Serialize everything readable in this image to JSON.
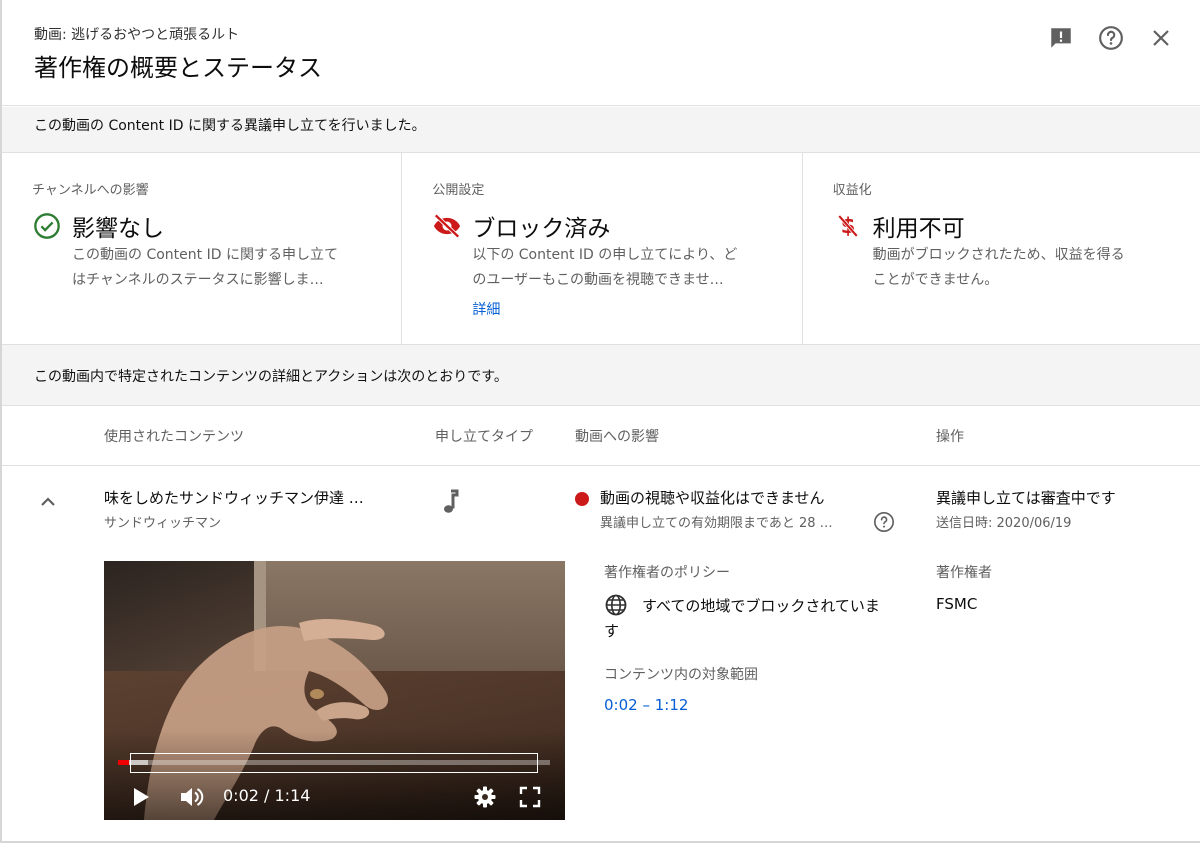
{
  "header": {
    "video_label": "動画: 逃げるおやつと頑張るルト",
    "title": "著作権の概要とステータス"
  },
  "banner": {
    "text": "この動画の Content ID に関する異議申し立てを行いました。"
  },
  "cards": [
    {
      "label": "チャンネルへの影響",
      "icon": "check-circle-icon",
      "status": "影響なし",
      "desc1": "この動画の Content ID に関する申し立て",
      "desc2": "はチャンネルのステータスに影響しま…",
      "color": "#2e7d32"
    },
    {
      "label": "公開設定",
      "icon": "eye-off-icon",
      "status": "ブロック済み",
      "desc1": "以下の Content ID の申し立てにより、ど",
      "desc2": "のユーザーもこの動画を視聴できませ…",
      "link": "詳細",
      "color": "#cc1a1a"
    },
    {
      "label": "収益化",
      "icon": "dollar-off-icon",
      "status": "利用不可",
      "desc1": "動画がブロックされたため、収益を得る",
      "desc2": "ことができません。",
      "color": "#cc1a1a"
    }
  ],
  "section": {
    "text": "この動画内で特定されたコンテンツの詳細とアクションは次のとおりです。"
  },
  "table": {
    "headers": [
      "使用されたコンテンツ",
      "申し立てタイプ",
      "動画への影響",
      "操作"
    ],
    "row": {
      "content_title": "味をしめたサンドウィッチマン伊達 …",
      "content_artist": "サンドウィッチマン",
      "claim_type_icon": "music-note-icon",
      "impact": "動画の視聴や収益化はできません",
      "impact_sub": "異議申し立ての有効期限まであと 28 …",
      "action": "異議申し立ては審査中です",
      "action_sub": "送信日時: 2020/06/19"
    }
  },
  "detail": {
    "policy_label": "著作権者のポリシー",
    "policy_value": "すべての地域でブロックされています",
    "owner_label": "著作権者",
    "owner_value": "FSMC",
    "range_label": "コンテンツ内の対象範囲",
    "range_value": "0:02 – 1:12"
  },
  "player": {
    "time": "0:02 / 1:14",
    "played_fraction": 0.025,
    "buffered_fraction": 0.07,
    "clip_start_fraction": 0.027,
    "clip_end_fraction": 0.973
  }
}
